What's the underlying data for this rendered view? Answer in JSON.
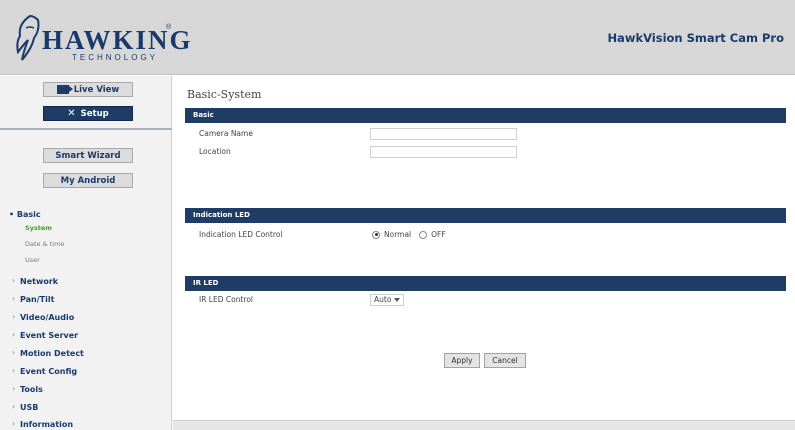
{
  "header": {
    "logo_text": "HAWKING",
    "logo_sub": "TECHNOLOGY",
    "logo_reg": "®",
    "product_title": "HawkVision Smart Cam Pro"
  },
  "sidebar": {
    "live_view_label": "Live View",
    "setup_label": "Setup",
    "smart_wizard_label": "Smart Wizard",
    "my_android_label": "My Android",
    "basic_label": "Basic",
    "basic_subitems": [
      "System",
      "Date & time",
      "User"
    ],
    "nav_items": [
      "Network",
      "Pan/Tilt",
      "Video/Audio",
      "Event Server",
      "Motion Detect",
      "Event Config",
      "Tools",
      "USB",
      "Information"
    ],
    "active_subitem": "System"
  },
  "main": {
    "page_title": "Basic-System",
    "sections": {
      "basic": "Basic",
      "indication_led": "Indication LED",
      "ir_led": "IR LED"
    },
    "fields": {
      "camera_name_label": "Camera Name",
      "camera_name_value": "",
      "location_label": "Location",
      "location_value": "",
      "indication_led_label": "Indication LED Control",
      "indication_led_options": [
        "Normal",
        "OFF"
      ],
      "indication_led_selected": "Normal",
      "ir_led_label": "IR LED Control",
      "ir_led_value": "Auto"
    },
    "buttons": {
      "apply": "Apply",
      "cancel": "Cancel"
    }
  },
  "colors": {
    "navy": "#1f3c66",
    "header_bg": "#d7d7d7",
    "active_green": "#4a9a2e"
  }
}
